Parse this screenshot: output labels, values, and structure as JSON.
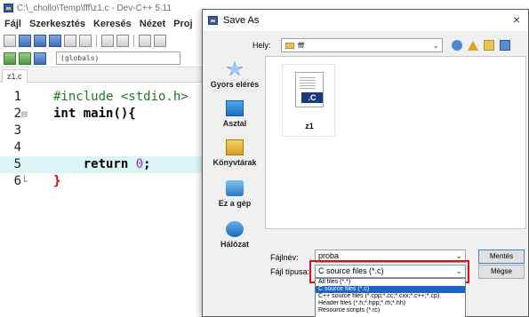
{
  "ide": {
    "title": "C:\\_chollo\\Temp\\fff\\z1.c - Dev-C++ 5.11",
    "menu": [
      "Fájl",
      "Szerkesztés",
      "Keresés",
      "Nézet",
      "Proj"
    ],
    "globals_combo": "(globals)",
    "file_tab": "z1.c",
    "code": [
      {
        "ln": "1",
        "fold": "",
        "parts": [
          {
            "cls": "c-pre",
            "t": "#include <stdio.h>"
          }
        ]
      },
      {
        "ln": "2",
        "fold": "⊟",
        "parts": [
          {
            "cls": "c-kw",
            "t": "int"
          },
          {
            "cls": "",
            "t": " "
          },
          {
            "cls": "c-kw",
            "t": "main(){"
          }
        ]
      },
      {
        "ln": "3",
        "fold": "",
        "parts": []
      },
      {
        "ln": "4",
        "fold": "",
        "parts": []
      },
      {
        "ln": "5",
        "fold": "",
        "parts": [
          {
            "cls": "c-kw",
            "t": "    return "
          },
          {
            "cls": "c-num",
            "t": "0"
          },
          {
            "cls": "c-kw",
            "t": ";"
          }
        ]
      },
      {
        "ln": "6",
        "fold": "└",
        "parts": [
          {
            "cls": "c-brace",
            "t": "}"
          }
        ]
      }
    ]
  },
  "dialog": {
    "title": "Save As",
    "close": "×",
    "lookin_label": "Hely:",
    "lookin_value": "fff",
    "places": [
      "Gyors elérés",
      "Asztal",
      "Könyvtárak",
      "Ez a gép",
      "Hálózat"
    ],
    "file_item": {
      "name": "z1",
      "badge": ".C"
    },
    "filename_label": "Fájlnév:",
    "filename_value": "proba",
    "filetype_label": "Fájl típusa:",
    "filetype_value": "C source files (*.c)",
    "filetype_options": [
      "All files (*.*)",
      "C source files (*.c)",
      "C++ source files (*.cpp;*.cc;*.cxx;*.c++;*.cp)",
      "Header files (*.h;*.hpp;*.rh;*.hh)",
      "Resource scripts (*.rc)"
    ],
    "filetype_selected_index": 1,
    "save_label": "Mentés",
    "cancel_label": "Mégse"
  },
  "colors": {
    "highlight_line": "#ddf5f6",
    "selection": "#1e64c8",
    "red_frame": "#e01010"
  }
}
